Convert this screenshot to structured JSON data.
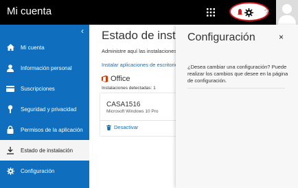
{
  "header": {
    "title": "Mi cuenta",
    "help_label": "?"
  },
  "sidebar": {
    "collapse_label": "‹",
    "items": [
      {
        "label": "Mi cuenta",
        "icon": "home-icon"
      },
      {
        "label": "Información personal",
        "icon": "person-icon"
      },
      {
        "label": "Suscripciones",
        "icon": "card-icon"
      },
      {
        "label": "Seguridad y privacidad",
        "icon": "key-icon"
      },
      {
        "label": "Permisos de la aplicación",
        "icon": "lock-icon"
      },
      {
        "label": "Estado de instalación",
        "icon": "download-icon",
        "active": true
      },
      {
        "label": "Configuración",
        "icon": "gear-icon"
      }
    ]
  },
  "main": {
    "title": "Estado de instalación",
    "subtitle": "Administre aquí las instalaciones",
    "install_link": "Instalar aplicaciones de escritorio",
    "product": "Office",
    "detected": "Instalaciones detectadas: 1",
    "device": {
      "name": "CASA1516",
      "os": "Microsoft Windows 10 Pro",
      "action": "Desactivar"
    }
  },
  "panel": {
    "title": "Configuración",
    "close_label": "×",
    "description": "¿Desea cambiar una configuración? Puede realizar los cambios que desee en la página de configuración."
  },
  "colors": {
    "topbar": "#000000",
    "sidebar": "#106ebe",
    "accent": "#106ebe",
    "office": "#d83b01",
    "highlight": "#e0141e"
  }
}
